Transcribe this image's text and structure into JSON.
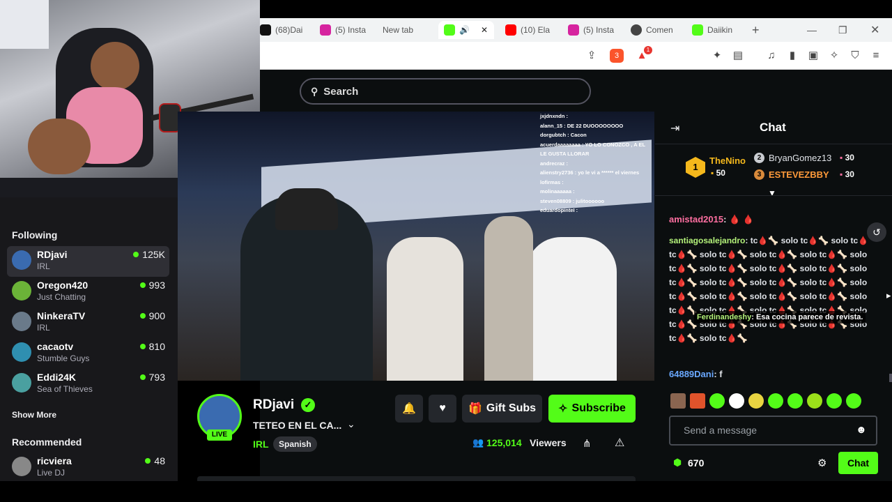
{
  "browser": {
    "tabs": [
      {
        "label": "(68)Dai",
        "icon": "tiktok-icon",
        "color": "#111111"
      },
      {
        "label": "(5) Insta",
        "icon": "instagram-icon",
        "color": "#d6249f"
      },
      {
        "label": "New tab",
        "icon": "",
        "color": "#f1f3f4"
      },
      {
        "label": "",
        "icon": "kick-icon",
        "color": "#53fc18"
      },
      {
        "label": "(10) Ela",
        "icon": "youtube-icon",
        "color": "#ff0000"
      },
      {
        "label": "(5) Insta",
        "icon": "instagram-icon",
        "color": "#d6249f"
      },
      {
        "label": "Comen",
        "icon": "chatgpt-icon",
        "color": "#444444"
      },
      {
        "label": "Daiikin",
        "icon": "kick-icon",
        "color": "#53fc18"
      }
    ],
    "brave_badge": "3",
    "alert_badge": "1"
  },
  "header": {
    "search_label": "Search"
  },
  "sidebar": {
    "following_title": "Following",
    "following": [
      {
        "name": "RDjavi",
        "category": "IRL",
        "viewers": "125K",
        "avatar_color": "#3a6bb0"
      },
      {
        "name": "Oregon420",
        "category": "Just Chatting",
        "viewers": "993",
        "avatar_color": "#6bb338"
      },
      {
        "name": "NinkeraTV",
        "category": "IRL",
        "viewers": "900",
        "avatar_color": "#6a7a8a"
      },
      {
        "name": "cacaotv",
        "category": "Stumble Guys",
        "viewers": "810",
        "avatar_color": "#2f8fb0"
      },
      {
        "name": "Eddi24K",
        "category": "Sea of Thieves",
        "viewers": "793",
        "avatar_color": "#4aa0a0"
      }
    ],
    "show_more": "Show More",
    "recommended_title": "Recommended",
    "recommended": [
      {
        "name": "ricviera",
        "category": "Live DJ",
        "viewers": "48",
        "avatar_color": "#888888"
      }
    ]
  },
  "player_overlay_chat": [
    "jxjdnxndn : ",
    "alann_15 : DE 22 DUOOOOOOOO",
    "dorgubtch : Cacon",
    "acuerdaaaaaaaa : YO LO CONOZCO , A EL",
    "LE GUSTA LLORAR",
    "andrecraz : ",
    "alienstry2736 : yo le vi a ****** el viernes",
    "lofirmas : ",
    "molinaaaaaa : ",
    "steven08809 : julitoooooo",
    "eduardopinteI : "
  ],
  "channel": {
    "name": "RDjavi",
    "live_label": "LIVE",
    "title": "TETEO EN EL CA...",
    "category": "IRL",
    "language": "Spanish",
    "viewers": "125,014",
    "viewers_label": "Viewers",
    "gift_label": "Gift Subs",
    "subscribe_label": "Subscribe"
  },
  "chat": {
    "title": "Chat",
    "leaders": [
      {
        "rank": "1",
        "name": "TheNino",
        "count": "50"
      },
      {
        "rank": "2",
        "name": "BryanGomez13",
        "count": "30"
      },
      {
        "rank": "3",
        "name": "ESTEVEZBBY",
        "count": "30"
      }
    ],
    "messages": [
      {
        "user": "amistad2015",
        "sep": ":",
        "text": "🩸 🩸",
        "color": "#ff6fa1"
      },
      {
        "user": "santiagosalejandro",
        "sep": ":",
        "text": "tc🩸🦴 solo tc🩸🦴 solo tc🩸 tc🩸🦴 solo tc🩸🦴 solo tc🩸🦴 solo tc🩸🦴 solo tc🩸🦴 solo tc🩸🦴 solo tc🩸🦴 solo tc🩸🦴 solo tc🩸🦴 solo tc🩸🦴 solo tc🩸🦴 solo tc🩸🦴 solo tc🩸🦴 solo tc🩸🦴 solo tc🩸🦴 solo tc🩸🦴 solo tc🩸🦴 solo tc🩸🦴 solo tc🩸🦴 solo tc🩸🦴 solo tc🩸🦴 solo tc🩸🦴 solo tc🩸🦴 solo tc🩸🦴 solo tc🩸🦴 solo tc🩸🦴",
        "color": "#b4f27a"
      },
      {
        "user": "64889Dani",
        "sep": ":",
        "text": "f",
        "color": "#6aa8ff"
      }
    ],
    "overlay_user": "Ferdinandeshy",
    "overlay_text": ": Esa cocina parece de revista.",
    "input_placeholder": "Send a message",
    "points": "670",
    "send_label": "Chat"
  }
}
